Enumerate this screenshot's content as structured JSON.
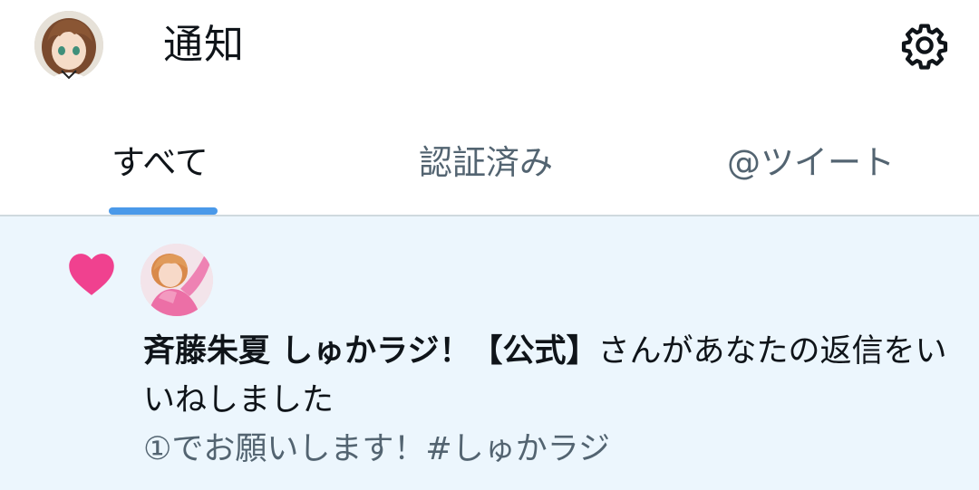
{
  "header": {
    "title": "通知",
    "avatar_icon": "user-avatar-icon",
    "settings_icon": "gear-icon"
  },
  "tabs": [
    {
      "label": "すべて",
      "active": true
    },
    {
      "label": "認証済み",
      "active": false
    },
    {
      "label": "@ツイート",
      "active": false
    }
  ],
  "notifications": [
    {
      "type": "like",
      "icon": "heart-icon",
      "actor_name": "斉藤朱夏 しゅかラジ！【公式】",
      "action_text": "さんがあなたの返信をいいねしました",
      "preview": "①でお願いします！#しゅかラジ"
    }
  ],
  "colors": {
    "accent": "#4a99e9",
    "like": "#f0418f",
    "highlight_bg": "#ecf6fd",
    "secondary_text": "#536471",
    "primary_text": "#0f1419",
    "divider": "#cfd9de"
  }
}
